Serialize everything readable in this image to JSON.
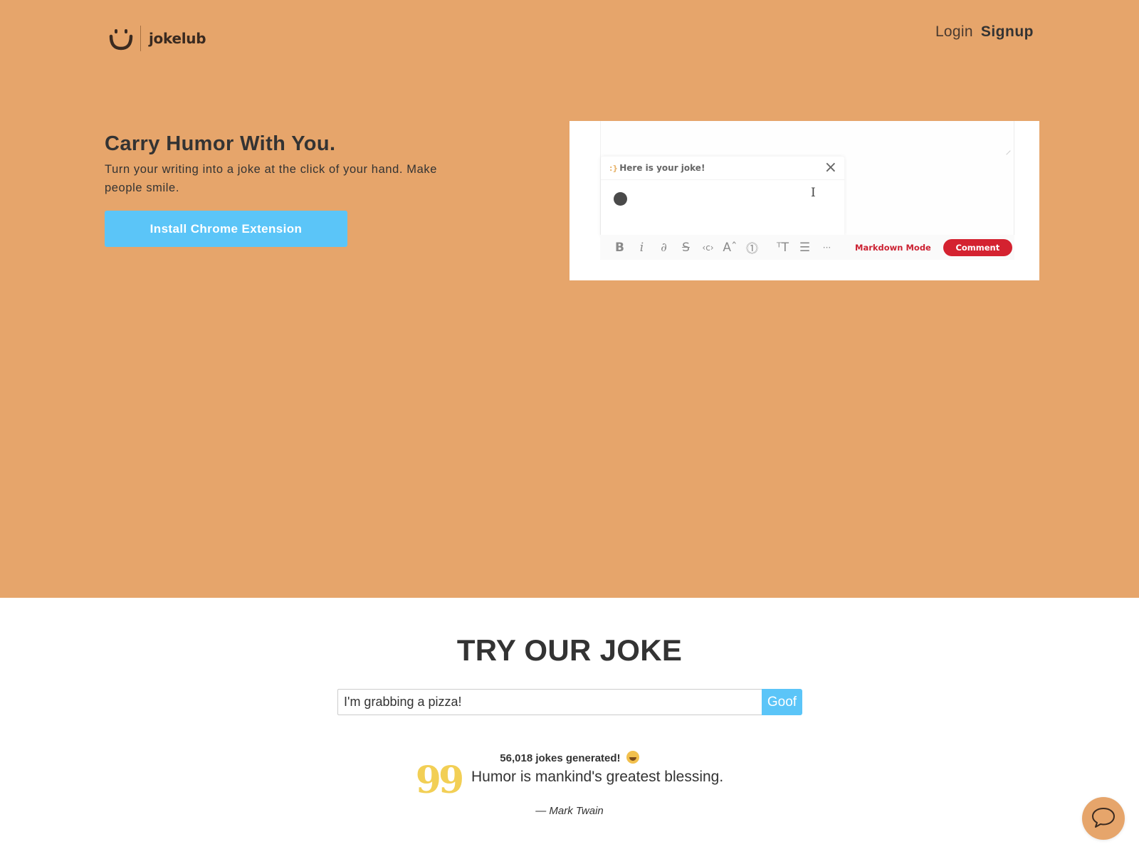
{
  "brand": {
    "name": "jokelub",
    "logo_icon": "smile-icon"
  },
  "nav": {
    "login": "Login",
    "signup": "Signup"
  },
  "hero": {
    "title": "Carry Humor With You.",
    "subtitle": "Turn your writing into a joke at the click of your hand. Make people smile.",
    "cta": "Install Chrome Extension",
    "background_color": "#e6a56b",
    "accent_color": "#5bc5f8"
  },
  "demo": {
    "popup_emoji": ":}",
    "popup_title": "Here is your joke!",
    "close_icon": "×",
    "text_cursor": "I",
    "toolbar": [
      {
        "name": "bold-icon",
        "glyph": "B"
      },
      {
        "name": "italic-icon",
        "glyph": "i"
      },
      {
        "name": "link-icon",
        "glyph": "∂"
      },
      {
        "name": "strikethrough-icon",
        "glyph": "S"
      },
      {
        "name": "code-icon",
        "glyph": "‹c›"
      },
      {
        "name": "font-size-icon",
        "glyph": "Aˆ"
      },
      {
        "name": "spoiler-icon",
        "glyph": "⓵"
      },
      {
        "name": "text-size-icon",
        "glyph": "ᵀT"
      },
      {
        "name": "bulleted-list-icon",
        "glyph": "☰"
      },
      {
        "name": "more-icon",
        "glyph": "···"
      }
    ],
    "markdown_mode": "Markdown Mode",
    "comment": "Comment",
    "comment_color": "#d42230"
  },
  "try": {
    "title": "TRY OUR JOKE",
    "input_value": "I'm grabbing a pizza!",
    "button": "Goof"
  },
  "stats": {
    "count_text": "56,018 jokes generated!",
    "emoji": "star-struck-emoji"
  },
  "quote": {
    "mark": "99",
    "text": "Humor is mankind's greatest blessing.",
    "author": "— Mark Twain"
  },
  "chat": {
    "icon": "chat-bubble-icon"
  }
}
